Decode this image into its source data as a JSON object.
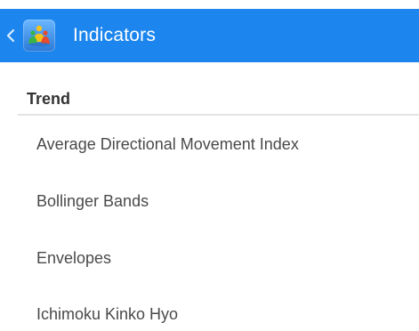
{
  "appbar": {
    "title": "Indicators",
    "accent_color": "#1c86ee",
    "back_icon": "chevron-left-icon",
    "app_icon": "metatrader-logo-icon"
  },
  "section": {
    "title": "Trend",
    "items": [
      {
        "label": "Average Directional Movement Index"
      },
      {
        "label": "Bollinger Bands"
      },
      {
        "label": "Envelopes"
      },
      {
        "label": "Ichimoku Kinko Hyo"
      }
    ]
  }
}
